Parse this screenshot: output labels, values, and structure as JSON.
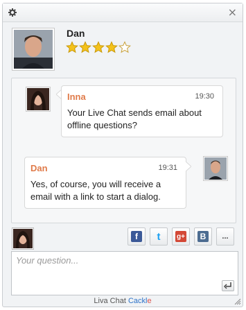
{
  "window": {
    "close_glyph": "×"
  },
  "operator": {
    "name": "Dan",
    "rating": 4,
    "rating_max": 5
  },
  "messages": [
    {
      "author": "Inna",
      "time": "19:30",
      "text": "Your Live Chat sends email about offline questions?"
    },
    {
      "author": "Dan",
      "time": "19:31",
      "text": "Yes, of course, you will receive a email with a link to start a dialog."
    }
  ],
  "share": {
    "facebook": "f",
    "twitter": "t",
    "googleplus": "g+",
    "vkontakte": "B",
    "more": "..."
  },
  "compose": {
    "placeholder": "Your question...",
    "value": ""
  },
  "footer": {
    "prefix": "Liva Chat ",
    "brand": "Cackl",
    "brand_tail": "e"
  },
  "colors": {
    "author": "#e07b4a",
    "brand": "#2e73c8",
    "star": "#f4c21b"
  }
}
